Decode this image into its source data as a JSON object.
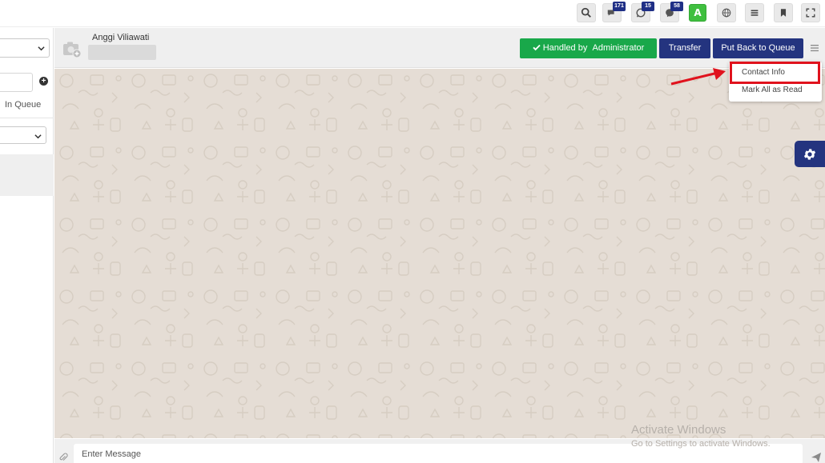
{
  "topbar": {
    "icons": [
      {
        "name": "search-icon"
      },
      {
        "name": "chat-bubbles-icon",
        "badge": "171"
      },
      {
        "name": "whatsapp-icon",
        "badge": "15"
      },
      {
        "name": "messenger-icon",
        "badge": "58"
      },
      {
        "name": "user-avatar",
        "label": "A"
      },
      {
        "name": "globe-icon"
      },
      {
        "name": "list-icon"
      },
      {
        "name": "bookmark-icon"
      },
      {
        "name": "fullscreen-icon"
      }
    ]
  },
  "sidebar": {
    "queue_label": "In Queue"
  },
  "chat_header": {
    "contact_name": "Anggi Viliawati",
    "handled_by_label": "Handled by",
    "handled_by_user": "Administrator",
    "transfer_label": "Transfer",
    "put_back_label": "Put Back to Queue"
  },
  "dropdown": {
    "items": [
      {
        "label": "Contact Info"
      },
      {
        "label": "Mark All as Read"
      }
    ]
  },
  "composer": {
    "placeholder": "Enter Message"
  },
  "watermark": {
    "title": "Activate Windows",
    "subtitle": "Go to Settings to activate Windows."
  },
  "colors": {
    "primary": "#24347f",
    "success": "#19a84a",
    "chat_bg": "#e5ddd5",
    "highlight": "#e0121d"
  }
}
